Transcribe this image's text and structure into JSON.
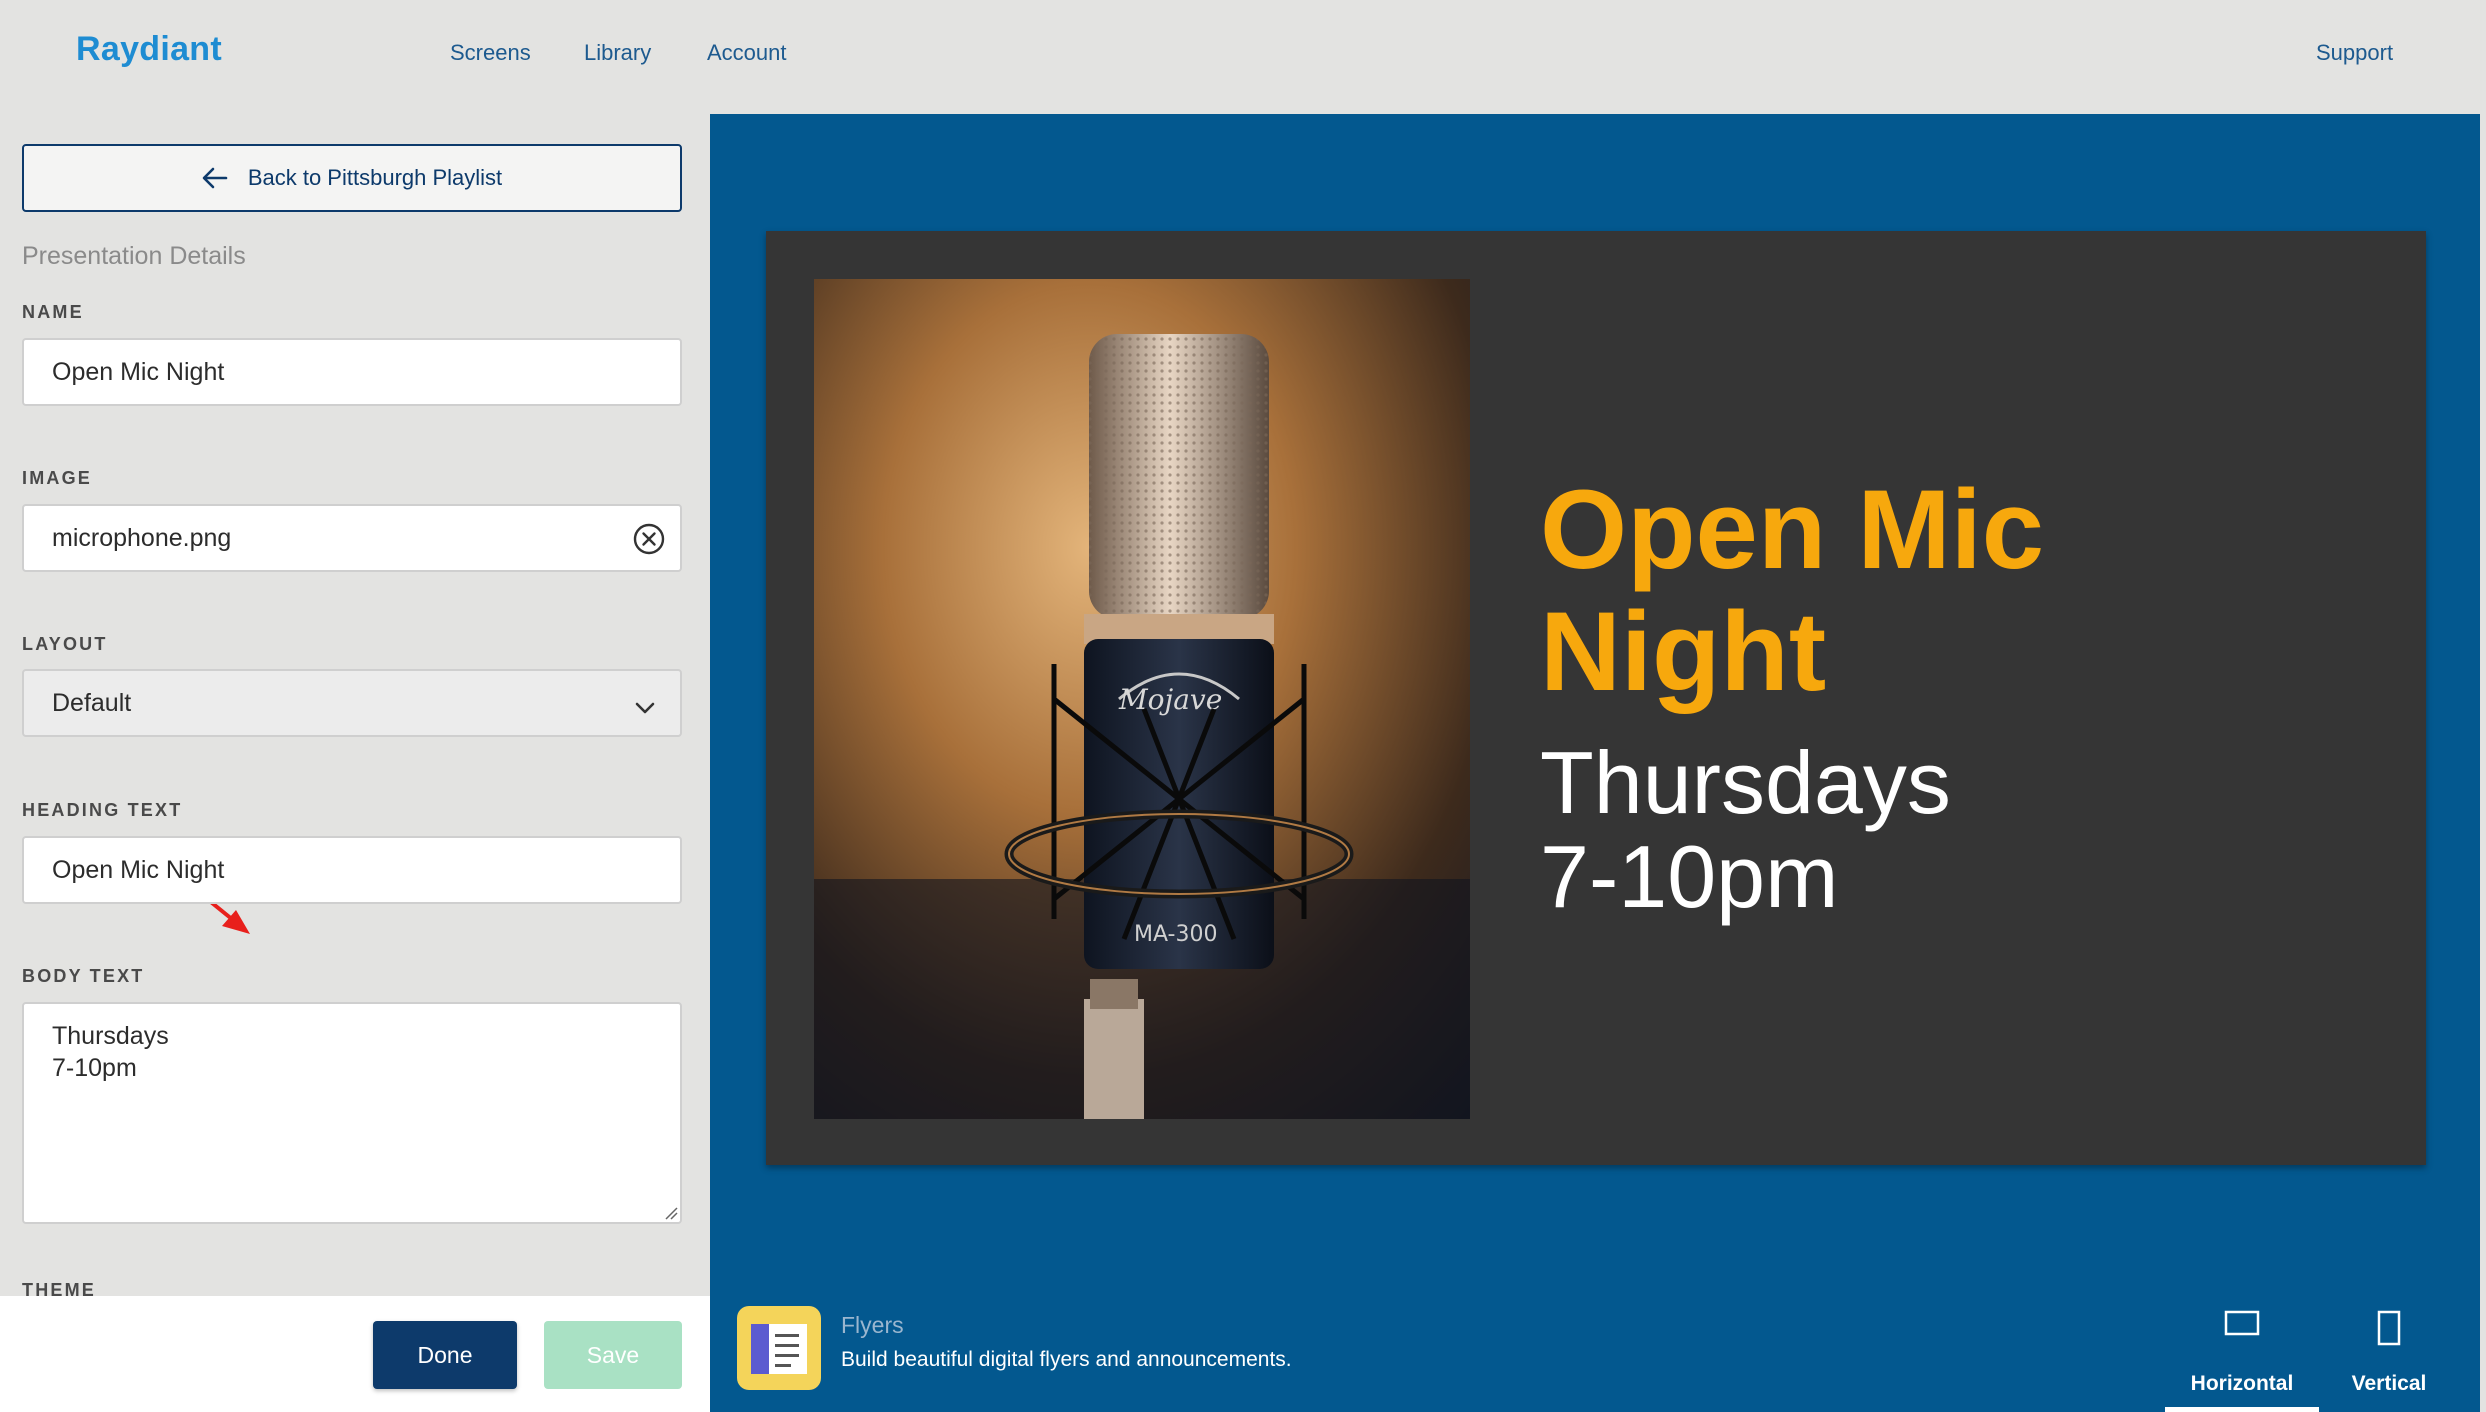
{
  "nav": {
    "logo": "Raydiant",
    "links": [
      "Screens",
      "Library",
      "Account"
    ],
    "support": "Support"
  },
  "sidebar": {
    "back_label": "Back to Pittsburgh Playlist",
    "section_title": "Presentation Details",
    "name": {
      "label": "NAME",
      "value": "Open Mic Night"
    },
    "image": {
      "label": "IMAGE",
      "value": "microphone.png"
    },
    "layout": {
      "label": "LAYOUT",
      "value": "Default"
    },
    "heading": {
      "label": "HEADING TEXT",
      "value": "Open Mic Night"
    },
    "body": {
      "label": "BODY TEXT",
      "value": "Thursdays\n7-10pm"
    },
    "theme": {
      "label": "THEME"
    }
  },
  "actions": {
    "done": "Done",
    "save": "Save"
  },
  "preview": {
    "heading": "Open Mic Night",
    "body": "Thursdays\n7-10pm",
    "colors": {
      "background": "#03588f",
      "slide": "#353535",
      "heading": "#f7a80d",
      "body": "#ffffff"
    }
  },
  "app": {
    "name": "Flyers",
    "description": "Build beautiful digital flyers and announcements."
  },
  "orientation": {
    "horizontal": "Horizontal",
    "vertical": "Vertical",
    "selected": "Horizontal"
  }
}
